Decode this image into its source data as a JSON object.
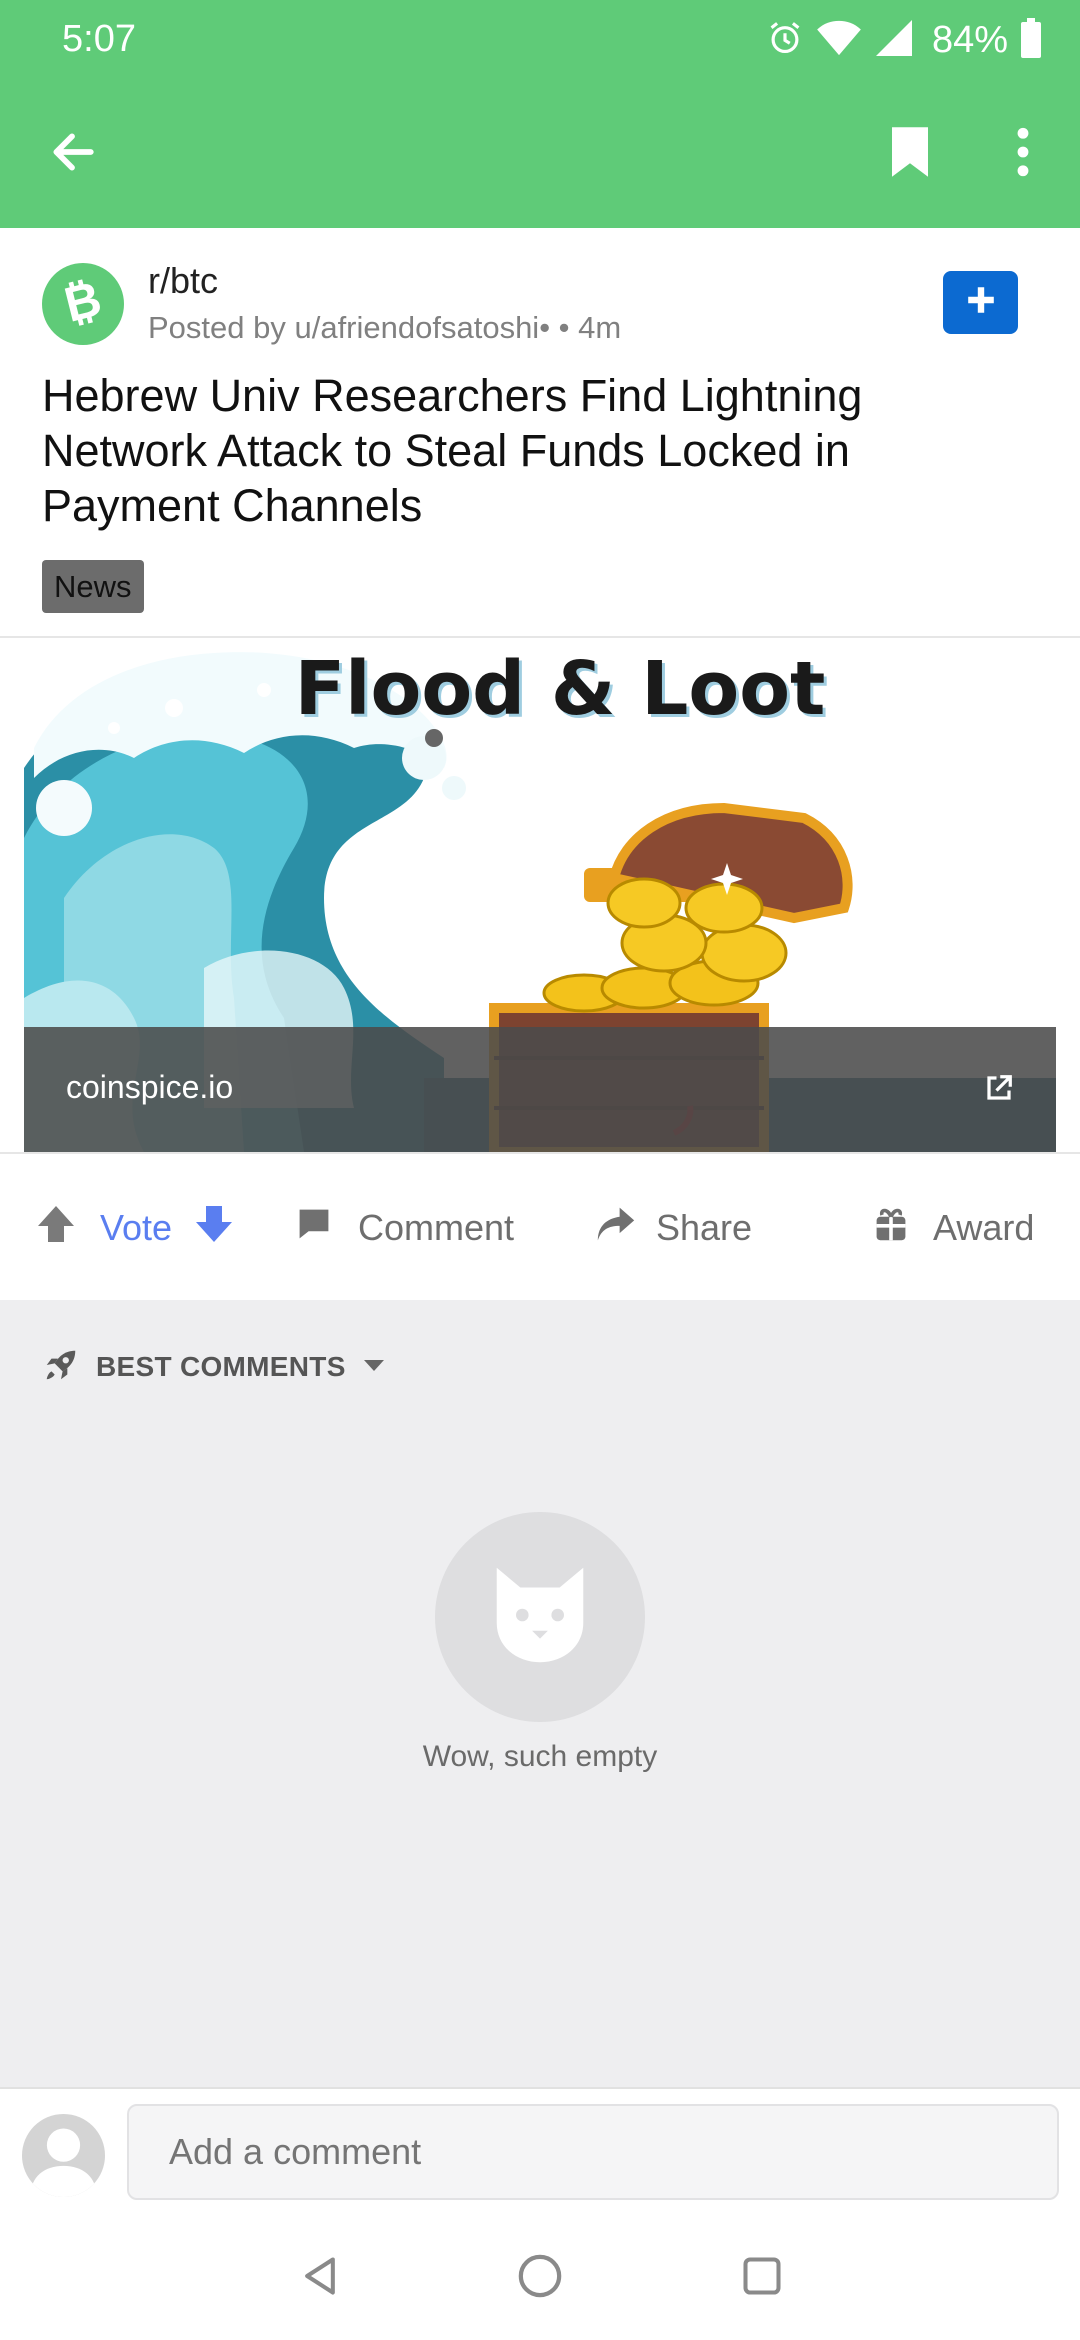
{
  "status_bar": {
    "time": "5:07",
    "battery": "84%",
    "icons": [
      "alarm-icon",
      "wifi-icon",
      "signal-icon",
      "battery-icon"
    ]
  },
  "app_bar": {
    "icons": [
      "back-arrow-icon",
      "bookmark-icon",
      "more-vert-icon"
    ]
  },
  "post": {
    "subreddit": "r/btc",
    "author_line": "Posted by u/afriendofsatoshi•",
    "age": " • 4m",
    "title": "Hebrew Univ Researchers Find Lightning Network Attack to Steal Funds Locked in Payment Channels",
    "flair": "News",
    "subreddit_icon": "bitcoin-cash-icon",
    "join_icon": "plus-icon"
  },
  "preview": {
    "image_text": "Flood & Loot",
    "domain": "coinspice.io",
    "image_description_icons": [
      "wave-illustration",
      "treasure-chest-illustration"
    ]
  },
  "actions": {
    "vote_label": "Vote",
    "comment_label": "Comment",
    "share_label": "Share",
    "award_label": "Award"
  },
  "comments": {
    "sort_label": "BEST COMMENTS",
    "empty_text": "Wow, such empty"
  },
  "comment_bar": {
    "placeholder": "Add a comment"
  },
  "colors": {
    "accent_green": "#5fcb78",
    "join_blue": "#0c6ad1",
    "vote_blue": "#5a7ef0"
  }
}
